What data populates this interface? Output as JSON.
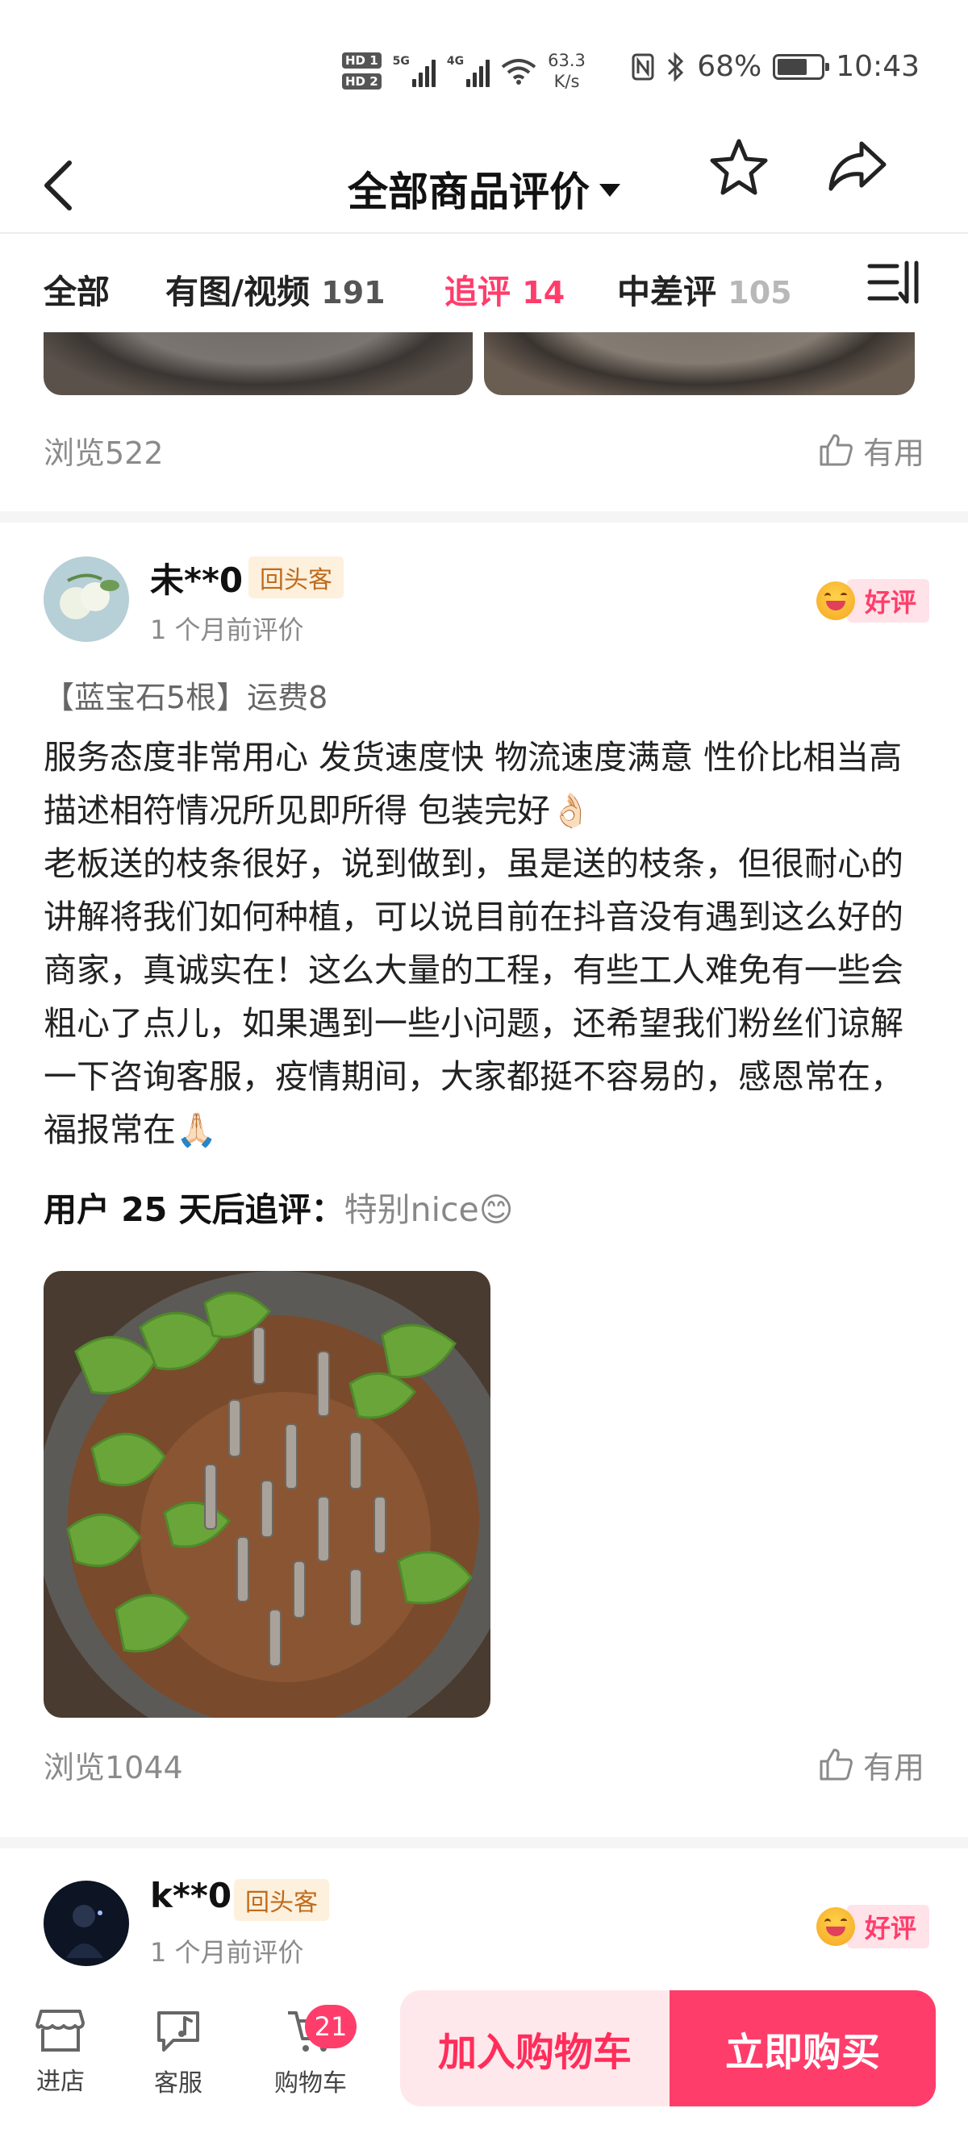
{
  "status_bar": {
    "hd1": "HD 1",
    "hd2": "HD 2",
    "sig1_tag": "5G",
    "sig2_tag": "4G",
    "net_speed": "63.3",
    "net_unit": "K/s",
    "battery_pct": "68%",
    "battery_level": 0.68,
    "time": "10:43"
  },
  "header": {
    "title": "全部商品评价",
    "back_icon": "chevron-left-icon",
    "favorite_icon": "star-icon",
    "share_icon": "share-arrow-icon"
  },
  "tabs": [
    {
      "label": "全部",
      "count": ""
    },
    {
      "label": "有图/视频",
      "count": "191"
    },
    {
      "label": "追评",
      "count": "14",
      "active": true
    },
    {
      "label": "中差评",
      "count": "105"
    }
  ],
  "prev_review": {
    "views": "浏览522",
    "useful": "有用"
  },
  "review": {
    "user": "未**0",
    "badge": "回头客",
    "time": "1 个月前评价",
    "rating": "好评",
    "sku": "【蓝宝石5根】运费8",
    "content_line1": "服务态度非常用心 发货速度快 物流速度满意 性价比相当高 描述相符情况所见即所得 包装完好👌🏻",
    "content_line2": "老板送的枝条很好，说到做到，虽是送的枝条，但很耐心的讲解将我们如何种植，可以说目前在抖音没有遇到这么好的商家，真诚实在！这么大量的工程，有些工人难免有一些会粗心了点儿，如果遇到一些小问题，还希望我们粉丝们谅解一下咨询客服，疫情期间，大家都挺不容易的，感恩常在，福报常在🙏🏻",
    "followup_label": "用户 25 天后追评：",
    "followup_text": "特别nice😊",
    "views": "浏览1044",
    "useful": "有用"
  },
  "next_review": {
    "user": "k**0",
    "badge": "回头客",
    "time": "1 个月前评价",
    "rating": "好评"
  },
  "bottom_bar": {
    "store": "进店",
    "service": "客服",
    "cart": "购物车",
    "cart_count": "21",
    "add_to_cart": "加入购物车",
    "buy_now": "立即购买"
  },
  "colors": {
    "accent": "#ff3d6b",
    "badge_text": "#c06b1c",
    "badge_bg": "#fdf0dc"
  }
}
